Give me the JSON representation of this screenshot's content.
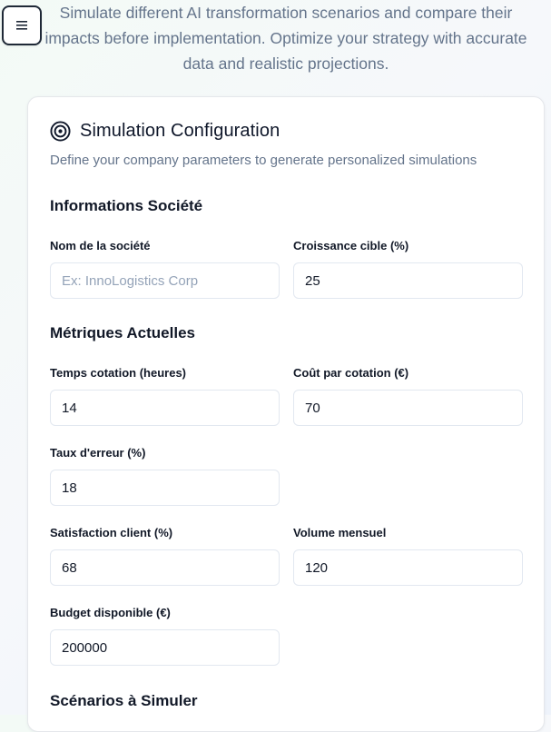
{
  "header": {
    "menu_icon": "hamburger-icon",
    "intro_text": "Simulate different AI transformation scenarios and compare their impacts before implementation. Optimize your strategy with accurate data and realistic projections."
  },
  "config": {
    "icon": "target-icon",
    "title": "Simulation Configuration",
    "subtitle": "Define your company parameters to generate personalized simulations",
    "sections": {
      "company": {
        "title": "Informations Société",
        "company_name": {
          "label": "Nom de la société",
          "value": "",
          "placeholder": "Ex: InnoLogistics Corp"
        },
        "target_growth": {
          "label": "Croissance cible (%)",
          "value": "25"
        }
      },
      "metrics": {
        "title": "Métriques Actuelles",
        "quote_time": {
          "label": "Temps cotation (heures)",
          "value": "14"
        },
        "cost_per_quote": {
          "label": "Coût par cotation (€)",
          "value": "70"
        },
        "error_rate": {
          "label": "Taux d'erreur (%)",
          "value": "18"
        },
        "customer_satisfaction": {
          "label": "Satisfaction client (%)",
          "value": "68"
        },
        "monthly_volume": {
          "label": "Volume mensuel",
          "value": "120"
        },
        "available_budget": {
          "label": "Budget disponible (€)",
          "value": "200000"
        }
      },
      "scenarios": {
        "title": "Scénarios à Simuler"
      }
    }
  },
  "colors": {
    "text_primary": "#0f172a",
    "text_muted": "#64748b",
    "border": "#e2e8f0"
  }
}
